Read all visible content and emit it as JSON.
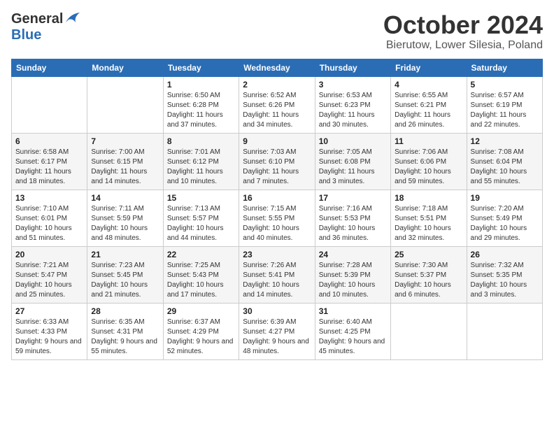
{
  "header": {
    "logo_general": "General",
    "logo_blue": "Blue",
    "month": "October 2024",
    "location": "Bierutow, Lower Silesia, Poland"
  },
  "weekdays": [
    "Sunday",
    "Monday",
    "Tuesday",
    "Wednesday",
    "Thursday",
    "Friday",
    "Saturday"
  ],
  "weeks": [
    [
      {
        "day": "",
        "info": ""
      },
      {
        "day": "",
        "info": ""
      },
      {
        "day": "1",
        "info": "Sunrise: 6:50 AM\nSunset: 6:28 PM\nDaylight: 11 hours and 37 minutes."
      },
      {
        "day": "2",
        "info": "Sunrise: 6:52 AM\nSunset: 6:26 PM\nDaylight: 11 hours and 34 minutes."
      },
      {
        "day": "3",
        "info": "Sunrise: 6:53 AM\nSunset: 6:23 PM\nDaylight: 11 hours and 30 minutes."
      },
      {
        "day": "4",
        "info": "Sunrise: 6:55 AM\nSunset: 6:21 PM\nDaylight: 11 hours and 26 minutes."
      },
      {
        "day": "5",
        "info": "Sunrise: 6:57 AM\nSunset: 6:19 PM\nDaylight: 11 hours and 22 minutes."
      }
    ],
    [
      {
        "day": "6",
        "info": "Sunrise: 6:58 AM\nSunset: 6:17 PM\nDaylight: 11 hours and 18 minutes."
      },
      {
        "day": "7",
        "info": "Sunrise: 7:00 AM\nSunset: 6:15 PM\nDaylight: 11 hours and 14 minutes."
      },
      {
        "day": "8",
        "info": "Sunrise: 7:01 AM\nSunset: 6:12 PM\nDaylight: 11 hours and 10 minutes."
      },
      {
        "day": "9",
        "info": "Sunrise: 7:03 AM\nSunset: 6:10 PM\nDaylight: 11 hours and 7 minutes."
      },
      {
        "day": "10",
        "info": "Sunrise: 7:05 AM\nSunset: 6:08 PM\nDaylight: 11 hours and 3 minutes."
      },
      {
        "day": "11",
        "info": "Sunrise: 7:06 AM\nSunset: 6:06 PM\nDaylight: 10 hours and 59 minutes."
      },
      {
        "day": "12",
        "info": "Sunrise: 7:08 AM\nSunset: 6:04 PM\nDaylight: 10 hours and 55 minutes."
      }
    ],
    [
      {
        "day": "13",
        "info": "Sunrise: 7:10 AM\nSunset: 6:01 PM\nDaylight: 10 hours and 51 minutes."
      },
      {
        "day": "14",
        "info": "Sunrise: 7:11 AM\nSunset: 5:59 PM\nDaylight: 10 hours and 48 minutes."
      },
      {
        "day": "15",
        "info": "Sunrise: 7:13 AM\nSunset: 5:57 PM\nDaylight: 10 hours and 44 minutes."
      },
      {
        "day": "16",
        "info": "Sunrise: 7:15 AM\nSunset: 5:55 PM\nDaylight: 10 hours and 40 minutes."
      },
      {
        "day": "17",
        "info": "Sunrise: 7:16 AM\nSunset: 5:53 PM\nDaylight: 10 hours and 36 minutes."
      },
      {
        "day": "18",
        "info": "Sunrise: 7:18 AM\nSunset: 5:51 PM\nDaylight: 10 hours and 32 minutes."
      },
      {
        "day": "19",
        "info": "Sunrise: 7:20 AM\nSunset: 5:49 PM\nDaylight: 10 hours and 29 minutes."
      }
    ],
    [
      {
        "day": "20",
        "info": "Sunrise: 7:21 AM\nSunset: 5:47 PM\nDaylight: 10 hours and 25 minutes."
      },
      {
        "day": "21",
        "info": "Sunrise: 7:23 AM\nSunset: 5:45 PM\nDaylight: 10 hours and 21 minutes."
      },
      {
        "day": "22",
        "info": "Sunrise: 7:25 AM\nSunset: 5:43 PM\nDaylight: 10 hours and 17 minutes."
      },
      {
        "day": "23",
        "info": "Sunrise: 7:26 AM\nSunset: 5:41 PM\nDaylight: 10 hours and 14 minutes."
      },
      {
        "day": "24",
        "info": "Sunrise: 7:28 AM\nSunset: 5:39 PM\nDaylight: 10 hours and 10 minutes."
      },
      {
        "day": "25",
        "info": "Sunrise: 7:30 AM\nSunset: 5:37 PM\nDaylight: 10 hours and 6 minutes."
      },
      {
        "day": "26",
        "info": "Sunrise: 7:32 AM\nSunset: 5:35 PM\nDaylight: 10 hours and 3 minutes."
      }
    ],
    [
      {
        "day": "27",
        "info": "Sunrise: 6:33 AM\nSunset: 4:33 PM\nDaylight: 9 hours and 59 minutes."
      },
      {
        "day": "28",
        "info": "Sunrise: 6:35 AM\nSunset: 4:31 PM\nDaylight: 9 hours and 55 minutes."
      },
      {
        "day": "29",
        "info": "Sunrise: 6:37 AM\nSunset: 4:29 PM\nDaylight: 9 hours and 52 minutes."
      },
      {
        "day": "30",
        "info": "Sunrise: 6:39 AM\nSunset: 4:27 PM\nDaylight: 9 hours and 48 minutes."
      },
      {
        "day": "31",
        "info": "Sunrise: 6:40 AM\nSunset: 4:25 PM\nDaylight: 9 hours and 45 minutes."
      },
      {
        "day": "",
        "info": ""
      },
      {
        "day": "",
        "info": ""
      }
    ]
  ]
}
